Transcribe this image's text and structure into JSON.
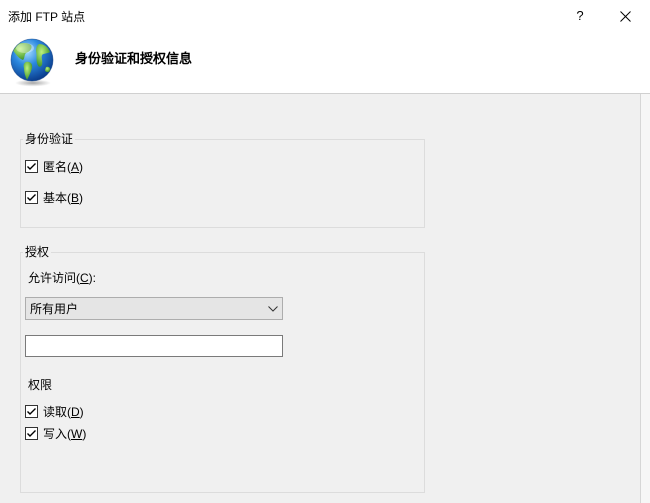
{
  "window": {
    "title": "添加 FTP 站点",
    "help_label": "?"
  },
  "header": {
    "title": "身份验证和授权信息"
  },
  "authentication": {
    "group_label": "身份验证",
    "options": [
      {
        "label": "匿名(A)",
        "access_key": "A",
        "checked": true
      },
      {
        "label": "基本(B)",
        "access_key": "B",
        "checked": true
      }
    ]
  },
  "authorization": {
    "group_label": "授权",
    "allow_access": {
      "label": "允许访问(C):",
      "access_key": "C",
      "selected": "所有用户"
    },
    "user_field": {
      "value": ""
    },
    "permissions": {
      "label": "权限",
      "options": [
        {
          "label": "读取(D)",
          "access_key": "D",
          "checked": true
        },
        {
          "label": "写入(W)",
          "access_key": "W",
          "checked": true
        }
      ]
    }
  },
  "icons": {
    "header": "globe-icon",
    "help": "help-icon",
    "close": "close-icon",
    "dropdown": "chevron-down-icon",
    "checkbox": "checkmark-icon"
  },
  "colors": {
    "header_bg": "#ffffff",
    "body_bg": "#f0f0f0",
    "group_border": "#dcdcdc",
    "dropdown_bg": "#e5e5e5",
    "input_border": "#7a7a7a"
  }
}
